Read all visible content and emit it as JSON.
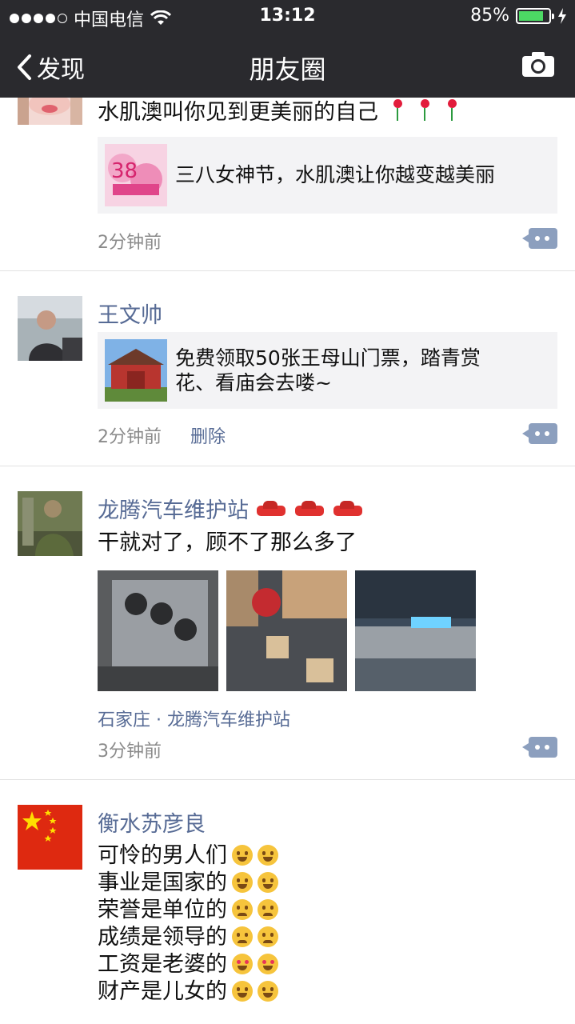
{
  "status": {
    "carrier": "中国电信",
    "time": "13:12",
    "battery": "85%",
    "battery_level": 0.85
  },
  "nav": {
    "back_label": "发现",
    "title": "朋友圈"
  },
  "posts": [
    {
      "text": "水肌澳叫你见到更美丽的自己",
      "link_title": "三八女神节，水肌澳让你越变越美丽",
      "time": "2分钟前"
    },
    {
      "name": "王文帅",
      "link_title_line1": "免费领取50张王母山门票，踏青赏",
      "link_title_line2": "花、看庙会去喽~",
      "time": "2分钟前",
      "delete_label": "删除"
    },
    {
      "name": "龙腾汽车维护站",
      "text": "干就对了，顾不了那么多了",
      "location": "石家庄 · 龙腾汽车维护站",
      "time": "3分钟前"
    },
    {
      "name": "衡水苏彦良",
      "lines": [
        "可怜的男人们",
        "事业是国家的",
        "荣誉是单位的",
        "成绩是领导的",
        "工资是老婆的",
        "财产是儿女的"
      ]
    }
  ],
  "icons": {
    "back": "chevron-left-icon",
    "camera": "camera-icon",
    "comment": "comment-icon",
    "wifi": "wifi-icon",
    "charging": "bolt-icon"
  },
  "colors": {
    "nav_bg": "#2a2a2e",
    "name_link": "#576b95",
    "battery": "#4cd964"
  }
}
